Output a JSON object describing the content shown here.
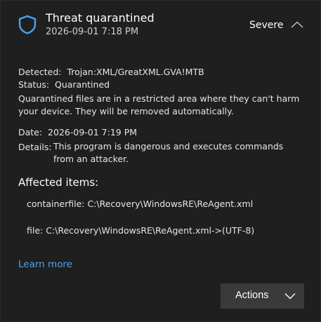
{
  "header": {
    "title": "Threat quarantined",
    "timestamp": "2026-09-01 7:18 PM",
    "severity": "Severe",
    "icon": "shield-icon",
    "accent_color": "#4aa3f0"
  },
  "details": {
    "detected_label": "Detected:",
    "detected_value": "Trojan:XML/GreatXML.GVA!MTB",
    "status_label": "Status:",
    "status_value": "Quarantined",
    "note_line1": "Quarantined files are in a restricted area where they can't harm",
    "note_line2": "your device. They will be removed automatically.",
    "date_label": "Date:",
    "date_value": "2026-09-01 7:19 PM",
    "details_label": "Details:",
    "details_line1": "This program is dangerous and executes commands",
    "details_line2": "from an attacker."
  },
  "affected": {
    "heading": "Affected items:",
    "items": [
      "containerfile: C:\\Recovery\\WindowsRE\\ReAgent.xml",
      "file: C:\\Recovery\\WindowsRE\\ReAgent.xml->(UTF-8)"
    ]
  },
  "links": {
    "learn_more": "Learn more"
  },
  "actions": {
    "label": "Actions"
  }
}
